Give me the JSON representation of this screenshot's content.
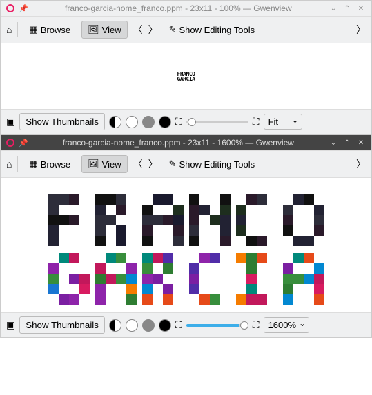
{
  "window1": {
    "title": "franco-garcia-nome_franco.ppm - 23x11 - 100% — Gwenview",
    "zoom": "Fit",
    "textTop": "FRANCO",
    "textBottom": "GARCIA"
  },
  "window2": {
    "title": "franco-garcia-nome_franco.ppm - 23x11 - 1600% — Gwenview",
    "zoom": "1600%"
  },
  "toolbar": {
    "browse": "Browse",
    "view": "View",
    "editing": "Show Editing Tools",
    "thumbnails": "Show Thumbnails"
  }
}
